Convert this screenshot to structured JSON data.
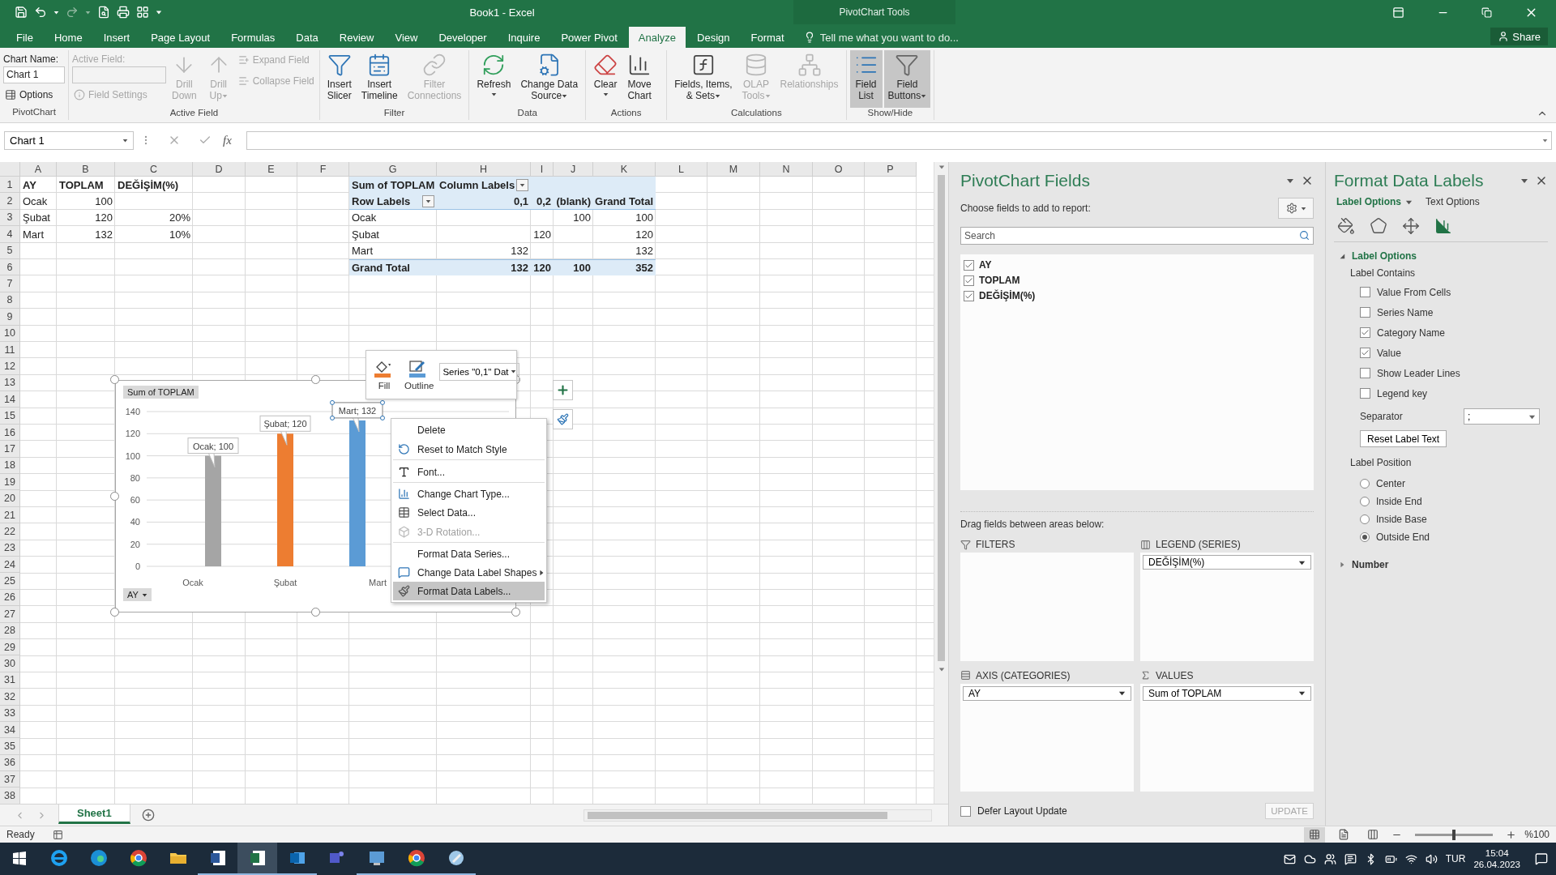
{
  "title_bar": {
    "title": "Book1 - Excel",
    "tools_label": "PivotChart Tools"
  },
  "ribbon_tabs": [
    {
      "label": "File",
      "selected": false
    },
    {
      "label": "Home",
      "selected": false
    },
    {
      "label": "Insert",
      "selected": false
    },
    {
      "label": "Page Layout",
      "selected": false
    },
    {
      "label": "Formulas",
      "selected": false
    },
    {
      "label": "Data",
      "selected": false
    },
    {
      "label": "Review",
      "selected": false
    },
    {
      "label": "View",
      "selected": false
    },
    {
      "label": "Developer",
      "selected": false
    },
    {
      "label": "Inquire",
      "selected": false
    },
    {
      "label": "Power Pivot",
      "selected": false
    },
    {
      "label": "Analyze",
      "selected": true
    },
    {
      "label": "Design",
      "selected": false
    },
    {
      "label": "Format",
      "selected": false
    }
  ],
  "tell_me": "Tell me what you want to do...",
  "share": "Share",
  "ribbon_groups": [
    {
      "label": "PivotChart",
      "columns": [
        [
          {
            "kind": "field",
            "label": "Chart Name:",
            "value": "Chart 1",
            "disabled": false
          },
          {
            "kind": "small",
            "label": "Options",
            "disabled": false
          }
        ]
      ]
    },
    {
      "label": "Active Field",
      "columns": [
        [
          {
            "kind": "field",
            "label": "Active Field:",
            "disabled": true
          },
          {
            "kind": "small",
            "label": "Field Settings",
            "disabled": true
          }
        ],
        [
          {
            "kind": "large",
            "label": "Drill\nDown",
            "disabled": true,
            "dropdown": false,
            "selected": false
          }
        ],
        [
          {
            "kind": "large",
            "label": "Drill\nUp",
            "disabled": true,
            "dropdown": true,
            "selected": false
          }
        ],
        [
          {
            "kind": "small",
            "label": "Expand Field",
            "disabled": true
          },
          {
            "kind": "small",
            "label": "Collapse Field",
            "disabled": true
          }
        ]
      ]
    },
    {
      "label": "Filter",
      "columns": [
        [
          {
            "kind": "large",
            "label": "Insert\nSlicer",
            "disabled": false,
            "dropdown": false,
            "selected": false
          }
        ],
        [
          {
            "kind": "large",
            "label": "Insert\nTimeline",
            "disabled": false,
            "dropdown": false,
            "selected": false
          }
        ],
        [
          {
            "kind": "large",
            "label": "Filter\nConnections",
            "disabled": true,
            "dropdown": false,
            "selected": false
          }
        ]
      ]
    },
    {
      "label": "Data",
      "columns": [
        [
          {
            "kind": "large",
            "label": "Refresh",
            "disabled": false,
            "dropdown": true,
            "selected": false
          }
        ],
        [
          {
            "kind": "large",
            "label": "Change Data\nSource",
            "disabled": false,
            "dropdown": true,
            "selected": false
          }
        ]
      ]
    },
    {
      "label": "Actions",
      "columns": [
        [
          {
            "kind": "large",
            "label": "Clear",
            "disabled": false,
            "dropdown": true,
            "selected": false
          }
        ],
        [
          {
            "kind": "large",
            "label": "Move\nChart",
            "disabled": false,
            "dropdown": false,
            "selected": false
          }
        ]
      ]
    },
    {
      "label": "Calculations",
      "columns": [
        [
          {
            "kind": "large",
            "label": "Fields, Items,\n& Sets",
            "disabled": false,
            "dropdown": true,
            "selected": false
          }
        ],
        [
          {
            "kind": "large",
            "label": "OLAP\nTools",
            "disabled": true,
            "dropdown": true,
            "selected": false
          }
        ],
        [
          {
            "kind": "large",
            "label": "Relationships",
            "disabled": true,
            "dropdown": false,
            "selected": false
          }
        ]
      ]
    },
    {
      "label": "Show/Hide",
      "columns": [
        [
          {
            "kind": "large",
            "label": "Field\nList",
            "disabled": false,
            "dropdown": false,
            "selected": true
          }
        ],
        [
          {
            "kind": "large",
            "label": "Field\nButtons",
            "disabled": false,
            "dropdown": true,
            "selected": true
          }
        ]
      ]
    }
  ],
  "formula_bar": {
    "name_box": "Chart 1",
    "fx": "fx"
  },
  "sheet": {
    "columns": [
      "A",
      "B",
      "C",
      "D",
      "E",
      "F",
      "G",
      "H",
      "I",
      "J",
      "K",
      "L",
      "M",
      "N",
      "O",
      "P"
    ],
    "rows": [
      {
        "header": "1",
        "kind": "band",
        "cells": [
          {
            "text": "AY",
            "kind": "bold_text"
          },
          {
            "text": "TOPLAM",
            "kind": "bold_text"
          },
          {
            "text": "DEĞİŞİM(%)",
            "kind": "bold_text"
          },
          null,
          null,
          null,
          {
            "text": "Sum of TOPLAM",
            "kind": "bold_text"
          },
          {
            "text": "Column Labels",
            "kind": "filter_label"
          }
        ]
      },
      {
        "header": "2",
        "kind": "band_rule_below",
        "cells": [
          {
            "text": "Ocak",
            "kind": "text"
          },
          {
            "text": "100",
            "kind": "number"
          },
          null,
          null,
          null,
          null,
          {
            "text": "Row Labels",
            "kind": "filter_label"
          },
          {
            "text": "0,1",
            "kind": "bold_number"
          },
          {
            "text": "0,2",
            "kind": "bold_number"
          },
          {
            "text": "(blank)",
            "kind": "bold_number"
          },
          {
            "text": "Grand Total",
            "kind": "bold_number"
          }
        ]
      },
      {
        "header": "3",
        "kind": "plain",
        "cells": [
          {
            "text": "Şubat",
            "kind": "text"
          },
          {
            "text": "120",
            "kind": "number"
          },
          {
            "text": "20%",
            "kind": "number"
          },
          null,
          null,
          null,
          {
            "text": "Ocak",
            "kind": "text"
          },
          null,
          null,
          {
            "text": "100",
            "kind": "number"
          },
          {
            "text": "100",
            "kind": "number"
          }
        ]
      },
      {
        "header": "4",
        "kind": "plain",
        "cells": [
          {
            "text": "Mart",
            "kind": "text"
          },
          {
            "text": "132",
            "kind": "number"
          },
          {
            "text": "10%",
            "kind": "number"
          },
          null,
          null,
          null,
          {
            "text": "Şubat",
            "kind": "text"
          },
          null,
          {
            "text": "120",
            "kind": "number"
          },
          null,
          {
            "text": "120",
            "kind": "number"
          }
        ]
      },
      {
        "header": "5",
        "kind": "plain",
        "cells": [
          null,
          null,
          null,
          null,
          null,
          null,
          {
            "text": "Mart",
            "kind": "text"
          },
          {
            "text": "132",
            "kind": "number"
          },
          null,
          null,
          {
            "text": "132",
            "kind": "number"
          }
        ]
      },
      {
        "header": "6",
        "kind": "band_rule_above",
        "cells": [
          null,
          null,
          null,
          null,
          null,
          null,
          {
            "text": "Grand Total",
            "kind": "bold_text"
          },
          {
            "text": "132",
            "kind": "bold_number"
          },
          {
            "text": "120",
            "kind": "bold_number"
          },
          {
            "text": "100",
            "kind": "bold_number"
          },
          {
            "text": "352",
            "kind": "bold_number"
          }
        ]
      },
      {
        "header": "7",
        "kind": "plain"
      },
      {
        "header": "8",
        "kind": "plain"
      },
      {
        "header": "9",
        "kind": "plain"
      },
      {
        "header": "10",
        "kind": "plain"
      },
      {
        "header": "11",
        "kind": "plain"
      },
      {
        "header": "12",
        "kind": "plain"
      },
      {
        "header": "13",
        "kind": "plain"
      },
      {
        "header": "14",
        "kind": "plain"
      },
      {
        "header": "15",
        "kind": "plain"
      },
      {
        "header": "16",
        "kind": "plain"
      },
      {
        "header": "17",
        "kind": "plain"
      },
      {
        "header": "18",
        "kind": "plain"
      },
      {
        "header": "19",
        "kind": "plain"
      },
      {
        "header": "20",
        "kind": "plain"
      },
      {
        "header": "21",
        "kind": "plain"
      },
      {
        "header": "22",
        "kind": "plain"
      },
      {
        "header": "23",
        "kind": "plain"
      },
      {
        "header": "24",
        "kind": "plain"
      },
      {
        "header": "25",
        "kind": "plain"
      },
      {
        "header": "26",
        "kind": "plain"
      },
      {
        "header": "27",
        "kind": "plain"
      },
      {
        "header": "28",
        "kind": "plain"
      },
      {
        "header": "29",
        "kind": "plain"
      },
      {
        "header": "30",
        "kind": "plain"
      },
      {
        "header": "31",
        "kind": "plain"
      },
      {
        "header": "32",
        "kind": "plain"
      },
      {
        "header": "33",
        "kind": "plain"
      },
      {
        "header": "34",
        "kind": "plain"
      },
      {
        "header": "35",
        "kind": "plain"
      },
      {
        "header": "36",
        "kind": "plain"
      },
      {
        "header": "37",
        "kind": "plain"
      },
      {
        "header": "38",
        "kind": "plain"
      }
    ]
  },
  "chart": {
    "value_field_button": "Sum of TOPLAM",
    "axis_field_button": "AY",
    "label_selected": [
      false,
      false,
      true
    ],
    "chart_data": {
      "type": "bar",
      "categories": [
        "Ocak",
        "Şubat",
        "Mart"
      ],
      "series": [
        {
          "color": "#5b9bd5",
          "values": [
            null,
            null,
            132
          ]
        },
        {
          "color": "#ed7d31",
          "values": [
            null,
            120,
            null
          ]
        },
        {
          "color": "#a5a5a5",
          "values": [
            100,
            null,
            null
          ]
        }
      ],
      "grid": true,
      "ylim": [
        0,
        140
      ],
      "yticks": [
        0,
        20,
        40,
        60,
        80,
        100,
        120,
        140
      ],
      "value_labels": [
        "Ocak; 100",
        "Şubat; 120",
        "Mart; 132"
      ]
    }
  },
  "mini_toolbar": {
    "buttons": [
      {
        "label": "Fill"
      },
      {
        "label": "Outline"
      }
    ],
    "series_select": "Series \"0,1\" Dat"
  },
  "context_menu": [
    {
      "label": "Delete",
      "disabled": false,
      "selected": false,
      "submenu": false,
      "separator_after": false
    },
    {
      "label": "Reset to Match Style",
      "disabled": false,
      "selected": false,
      "submenu": false,
      "separator_after": true
    },
    {
      "label": "Font...",
      "disabled": false,
      "selected": false,
      "submenu": false,
      "separator_after": true
    },
    {
      "label": "Change Chart Type...",
      "disabled": false,
      "selected": false,
      "submenu": false,
      "separator_after": false
    },
    {
      "label": "Select Data...",
      "disabled": false,
      "selected": false,
      "submenu": false,
      "separator_after": false
    },
    {
      "label": "3-D Rotation...",
      "disabled": true,
      "selected": false,
      "submenu": false,
      "separator_after": true
    },
    {
      "label": "Format Data Series...",
      "disabled": false,
      "selected": false,
      "submenu": false,
      "separator_after": false
    },
    {
      "label": "Change Data Label Shapes",
      "disabled": false,
      "selected": false,
      "submenu": true,
      "separator_after": false
    },
    {
      "label": "Format Data Labels...",
      "disabled": false,
      "selected": true,
      "submenu": false,
      "separator_after": false
    }
  ],
  "sheet_tabs": [
    {
      "label": "Sheet1",
      "selected": true
    }
  ],
  "pivot_fields": {
    "title": "PivotChart Fields",
    "subtitle": "Choose fields to add to report:",
    "search_placeholder": "Search",
    "fields": [
      {
        "label": "AY",
        "checked": true
      },
      {
        "label": "TOPLAM",
        "checked": true
      },
      {
        "label": "DEĞİŞİM(%)",
        "checked": true
      }
    ],
    "drag_hint": "Drag fields between areas below:",
    "areas": [
      {
        "kind": "filters",
        "label": "FILTERS"
      },
      {
        "kind": "legend",
        "label": "LEGEND (SERIES)",
        "items": [
          "DEĞİŞİM(%)"
        ]
      },
      {
        "kind": "axis",
        "label": "AXIS (CATEGORIES)",
        "items": [
          "AY"
        ]
      },
      {
        "kind": "values",
        "label": "VALUES",
        "items": [
          "Sum of TOPLAM"
        ]
      }
    ],
    "defer": {
      "label": "Defer Layout Update",
      "checked": false
    },
    "update_button": {
      "label": "UPDATE",
      "disabled": true
    }
  },
  "format_pane": {
    "title": "Format Data Labels",
    "tabs": [
      {
        "label": "Label Options",
        "selected": true
      },
      {
        "label": "Text Options",
        "selected": false
      }
    ],
    "icon_tabs": [
      {
        "selected": false
      },
      {
        "selected": false
      },
      {
        "selected": false
      },
      {
        "selected": true
      }
    ],
    "section": {
      "label": "Label Options",
      "expanded": true
    },
    "contains_label": "Label Contains",
    "options": [
      {
        "label": "Value From Cells",
        "checked": false
      },
      {
        "label": "Series Name",
        "checked": false
      },
      {
        "label": "Category Name",
        "checked": true
      },
      {
        "label": "Value",
        "checked": true
      },
      {
        "label": "Show Leader Lines",
        "checked": false
      },
      {
        "label": "Legend key",
        "checked": false
      }
    ],
    "separator": {
      "label": "Separator",
      "value": ";"
    },
    "reset_button": "Reset Label Text",
    "position_label": "Label Position",
    "positions": [
      {
        "label": "Center",
        "selected": false
      },
      {
        "label": "Inside End",
        "selected": false
      },
      {
        "label": "Inside Base",
        "selected": false
      },
      {
        "label": "Outside End",
        "selected": true
      }
    ],
    "number_section": {
      "label": "Number",
      "expanded": false
    }
  },
  "status_bar": {
    "text": "Ready",
    "views": [
      {
        "selected": true
      },
      {
        "selected": false
      },
      {
        "selected": false
      }
    ],
    "zoom": {
      "level": 0.5,
      "label": "%100"
    }
  },
  "taskbar": {
    "apps": [
      {
        "kind": "ie",
        "running": false,
        "selected": false
      },
      {
        "kind": "edge",
        "running": false,
        "selected": false
      },
      {
        "kind": "chrome",
        "running": false,
        "selected": false
      },
      {
        "kind": "files",
        "running": false,
        "selected": false
      },
      {
        "kind": "word",
        "running": true,
        "selected": false
      },
      {
        "kind": "excel",
        "running": true,
        "selected": true
      },
      {
        "kind": "outlook",
        "running": true,
        "selected": false
      },
      {
        "kind": "teams",
        "running": false,
        "selected": false
      },
      {
        "kind": "app",
        "running": true,
        "selected": false
      },
      {
        "kind": "chrome",
        "running": true,
        "selected": false
      },
      {
        "kind": "app2",
        "running": true,
        "selected": false
      }
    ],
    "language": "TUR",
    "time": "15:04",
    "date": "26.04.2023"
  }
}
